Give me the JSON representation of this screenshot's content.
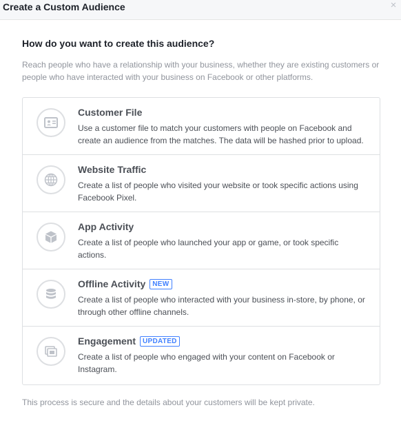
{
  "dialog": {
    "title": "Create a Custom Audience",
    "close_label": "×"
  },
  "question": "How do you want to create this audience?",
  "intro": "Reach people who have a relationship with your business, whether they are existing customers or people who have interacted with your business on Facebook or other platforms.",
  "options": [
    {
      "title": "Customer File",
      "badge": "",
      "description": "Use a customer file to match your customers with people on Facebook and create an audience from the matches. The data will be hashed prior to upload.",
      "icon": "contact-card-icon"
    },
    {
      "title": "Website Traffic",
      "badge": "",
      "description": "Create a list of people who visited your website or took specific actions using Facebook Pixel.",
      "icon": "globe-icon"
    },
    {
      "title": "App Activity",
      "badge": "",
      "description": "Create a list of people who launched your app or game, or took specific actions.",
      "icon": "cube-icon"
    },
    {
      "title": "Offline Activity",
      "badge": "NEW",
      "description": "Create a list of people who interacted with your business in-store, by phone, or through other offline channels.",
      "icon": "database-icon"
    },
    {
      "title": "Engagement",
      "badge": "UPDATED",
      "description": "Create a list of people who engaged with your content on Facebook or Instagram.",
      "icon": "stacked-cards-icon"
    }
  ],
  "footer_note": "This process is secure and the details about your customers will be kept private.",
  "colors": {
    "header_bg": "#f6f7f9",
    "border": "#dddfe2",
    "muted_text": "#90949c",
    "body_text": "#4b4f56",
    "badge_blue": "#4080ff",
    "icon_gray": "#bec2c9"
  }
}
